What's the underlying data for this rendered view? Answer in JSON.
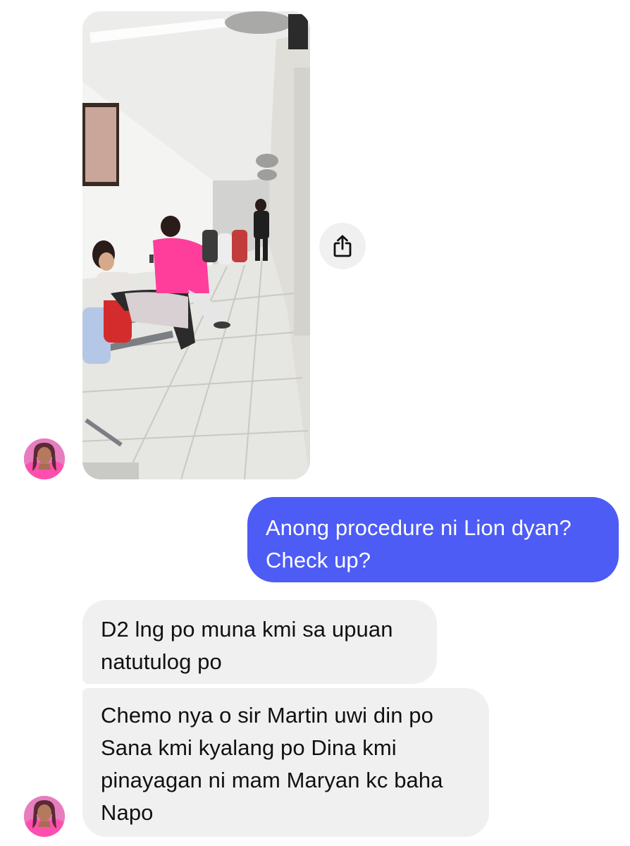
{
  "chat": {
    "photo_message": {
      "alt": "Photo of a hospital hallway with people waiting on benches",
      "share_icon": "share-icon"
    },
    "outgoing_message": {
      "lines": [
        "Anong procedure ni Lion dyan?",
        "Check up?"
      ]
    },
    "incoming_message_1": {
      "lines": [
        "D2 lng po muna kmi sa upuan",
        "natutulog po"
      ]
    },
    "incoming_message_2": {
      "lines": [
        "Chemo nya o sir Martin uwi din po",
        "Sana kmi kyalang po Dina kmi",
        "pinayagan ni mam Maryan kc baha",
        "Napo"
      ]
    },
    "avatar_icon": "contact-avatar"
  },
  "colors": {
    "outgoing_bubble": "#4d5cf5",
    "incoming_bubble": "#f0f0f0",
    "background": "#ffffff"
  }
}
